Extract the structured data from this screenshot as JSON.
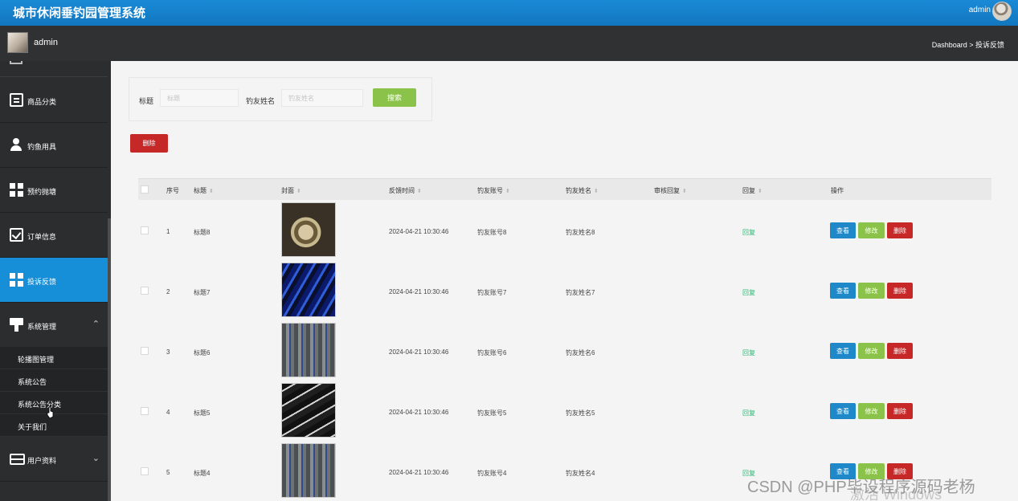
{
  "app": {
    "title": "城市休闲垂钓园管理系统",
    "user": "admin"
  },
  "header2": {
    "username": "admin",
    "breadcrumb": "Dashboard > 投诉反馈"
  },
  "sidebar": {
    "items": [
      {
        "label": "商品分类",
        "icon": "clipboard-icon"
      },
      {
        "label": "钓鱼用具",
        "icon": "user-icon"
      },
      {
        "label": "预约抛塘",
        "icon": "grid-icon"
      },
      {
        "label": "订单信息",
        "icon": "checklist-icon"
      },
      {
        "label": "投诉反馈",
        "icon": "grid-icon"
      },
      {
        "label": "系统管理",
        "icon": "brush-icon",
        "chevron": "⌃"
      },
      {
        "label": "用户资料",
        "icon": "card-icon",
        "chevron": "⌄"
      }
    ],
    "subitems": [
      "轮播图管理",
      "系统公告",
      "系统公告分类",
      "关于我们"
    ]
  },
  "search": {
    "title_label": "标题",
    "title_placeholder": "标题",
    "name_label": "钓友姓名",
    "name_placeholder": "钓友姓名",
    "button": "搜索"
  },
  "delete_button": "删除",
  "table": {
    "headers": [
      "序号",
      "标题",
      "封面",
      "反馈时间",
      "钓友账号",
      "钓友姓名",
      "审核回复",
      "回复",
      "操作"
    ],
    "rows": [
      {
        "no": "1",
        "title": "标题8",
        "time": "2024-04-21 10:30:46",
        "account": "钓友账号8",
        "name": "钓友姓名8",
        "reply": "回复"
      },
      {
        "no": "2",
        "title": "标题7",
        "time": "2024-04-21 10:30:46",
        "account": "钓友账号7",
        "name": "钓友姓名7",
        "reply": "回复"
      },
      {
        "no": "3",
        "title": "标题6",
        "time": "2024-04-21 10:30:46",
        "account": "钓友账号6",
        "name": "钓友姓名6",
        "reply": "回复"
      },
      {
        "no": "4",
        "title": "标题5",
        "time": "2024-04-21 10:30:46",
        "account": "钓友账号5",
        "name": "钓友姓名5",
        "reply": "回复"
      },
      {
        "no": "5",
        "title": "标题4",
        "time": "2024-04-21 10:30:46",
        "account": "钓友账号4",
        "name": "钓友姓名4",
        "reply": "回复"
      }
    ],
    "actions": {
      "view": "查看",
      "edit": "修改",
      "delete": "删除"
    }
  },
  "watermark": {
    "csdn": "CSDN @PHP毕设程序源码老杨",
    "windows": "激活 Windows"
  }
}
